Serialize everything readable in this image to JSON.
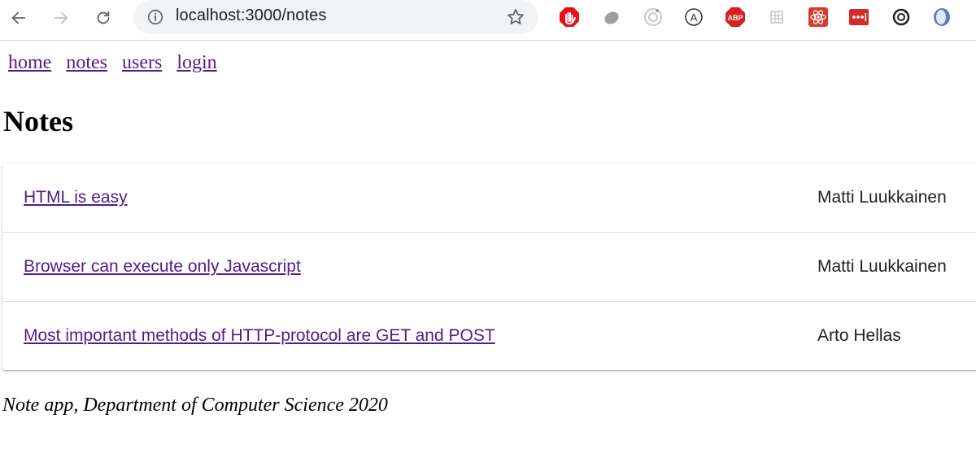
{
  "browser": {
    "url": "localhost:3000/notes"
  },
  "icons": {
    "back": "arrow-left-icon",
    "forward": "arrow-right-icon",
    "reload": "reload-icon",
    "info": "info-icon",
    "bookmark": "star-icon"
  },
  "extensions": [
    {
      "name": "adblock-hand",
      "color": "#e8101a"
    },
    {
      "name": "grey-leaf",
      "color": "#9e9e9e"
    },
    {
      "name": "circle-target",
      "color": "#bdbdbd"
    },
    {
      "name": "letter-a",
      "color": "#333333",
      "label": "A"
    },
    {
      "name": "abp",
      "color": "#d9201c",
      "label": "ABP"
    },
    {
      "name": "tiny-grid",
      "color": "#888888"
    },
    {
      "name": "react-devtools",
      "color": "#d63b2f"
    },
    {
      "name": "lastpass",
      "color": "#d32d27",
      "label": "•••|"
    },
    {
      "name": "sync-circle",
      "color": "#222222"
    },
    {
      "name": "blue-oval",
      "color": "#5a7fc0"
    }
  ],
  "nav": {
    "home": "home",
    "notes": "notes",
    "users": "users",
    "login": "login"
  },
  "page": {
    "title": "Notes"
  },
  "notes": [
    {
      "content": "HTML is easy",
      "author": "Matti Luukkainen"
    },
    {
      "content": "Browser can execute only Javascript",
      "author": "Matti Luukkainen"
    },
    {
      "content": "Most important methods of HTTP-protocol are GET and POST",
      "author": "Arto Hellas"
    }
  ],
  "footer": {
    "text": "Note app, Department of Computer Science 2020"
  },
  "colors": {
    "link": "#551a8b",
    "omnibox_bg": "#f1f3f4"
  }
}
